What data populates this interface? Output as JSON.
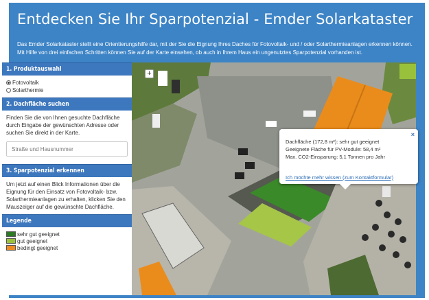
{
  "header": {
    "title": "Entdecken Sie Ihr Sparpotenzial - Emder Solarkataster",
    "description": "Das Emder Solarkataster stellt eine Orientierungshilfe dar, mit der Sie die Eignung Ihres Daches für Fotovoltaik- und / oder Solarthermieanlagen erkennen können. Mit Hilfe von drei einfachen Schritten können Sie auf der Karte einsehen, ob auch in Ihrem Haus ein ungenutztes Sparpotenzial vorhanden ist."
  },
  "sidebar": {
    "product": {
      "heading": "1. Produktauswahl",
      "options": [
        {
          "label": "Fotovoltaik",
          "selected": true
        },
        {
          "label": "Solarthermie",
          "selected": false
        }
      ]
    },
    "search": {
      "heading": "2. Dachfläche suchen",
      "text": "Finden Sie die von Ihnen gesuchte Dachfläche durch Eingabe der gewünschten Adresse oder suchen Sie direkt in der Karte.",
      "placeholder": "Straße und Hausnummer",
      "value": ""
    },
    "potential": {
      "heading": "3. Sparpotenzial erkennen",
      "text": "Um jetzt auf einen Blick Informationen über die Eignung für den Einsatz von Fotovoltaik- bzw. Solarthermieanlagen zu erhalten, klicken Sie den Mauszeiger auf die gewünschte Dachfläche."
    },
    "legend": {
      "heading": "Legende",
      "items": [
        {
          "label": "sehr gut geeignet",
          "color": "#2c7a23"
        },
        {
          "label": "gut geeignet",
          "color": "#9ac13b"
        },
        {
          "label": "bedingt geeignet",
          "color": "#ee8a1f"
        }
      ]
    }
  },
  "map": {
    "zoom_in_label": "+",
    "popup": {
      "line1": "Dachfläche (172,8 m²): sehr gut geeignet",
      "line2": "Geeignete Fläche für PV-Module: 58,4 m²",
      "line3": "Max. CO2-Einsparung: 5,1 Tonnen pro Jahr",
      "link": "Ich möchte mehr wissen (zum Kontaktformular)",
      "close": "×"
    }
  }
}
